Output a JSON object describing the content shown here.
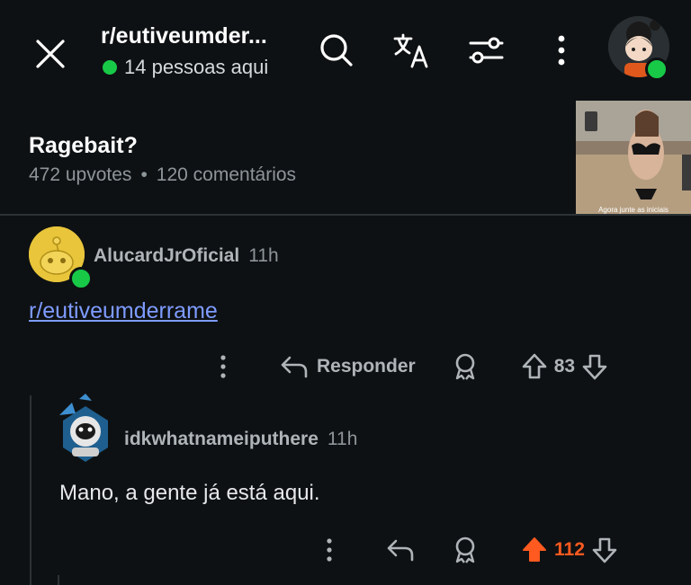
{
  "header": {
    "subreddit": "r/eutiveumder...",
    "online_text": "14 pessoas aqui",
    "icons": [
      "close-icon",
      "search-icon",
      "translate-icon",
      "filter-icon",
      "more-vertical-icon",
      "user-avatar"
    ]
  },
  "post": {
    "title": "Ragebait?",
    "upvotes": "472 upvotes",
    "separator": "•",
    "comments": "120 comentários",
    "thumbnail_caption": "Agora junte as iniciais"
  },
  "comments": [
    {
      "username": "AlucardJrOficial",
      "time": "11h",
      "body": "r/eutiveumderrame",
      "reply_label": "Responder",
      "score": "83",
      "upvoted": false
    },
    {
      "username": "idkwhatnameiputhere",
      "time": "11h",
      "body": "Mano, a gente já está aqui.",
      "score": "112",
      "upvoted": true
    }
  ],
  "colors": {
    "background": "#0e1113",
    "online": "#18c948",
    "link": "#7e9bff",
    "upvote_active": "#ff5a1f"
  }
}
